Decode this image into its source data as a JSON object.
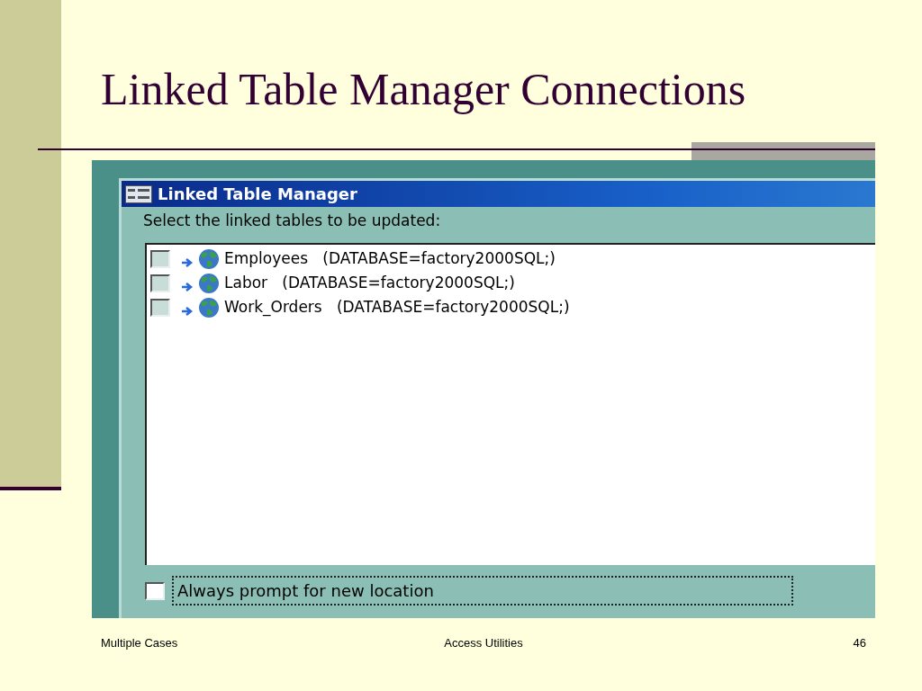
{
  "slide": {
    "title": "Linked Table Manager Connections"
  },
  "dialog": {
    "title": "Linked Table Manager",
    "prompt": "Select the linked tables to be updated:",
    "tables": [
      {
        "label": "Employees   (DATABASE=factory2000SQL;)",
        "checked": false
      },
      {
        "label": "Labor   (DATABASE=factory2000SQL;)",
        "checked": false
      },
      {
        "label": "Work_Orders   (DATABASE=factory2000SQL;)",
        "checked": false
      }
    ],
    "always_prompt": {
      "label": "Always prompt for new location",
      "checked": false,
      "focused": true
    }
  },
  "footer": {
    "left": "Multiple Cases",
    "center": "Access Utilities",
    "page": "46"
  }
}
